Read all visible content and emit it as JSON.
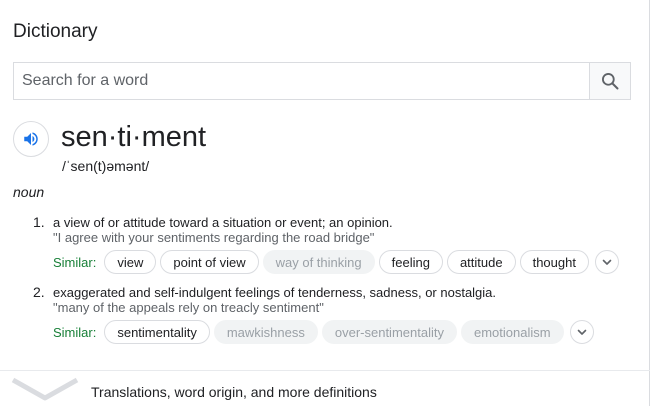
{
  "title": "Dictionary",
  "search": {
    "placeholder": "Search for a word"
  },
  "entry": {
    "word": "sen·ti·ment",
    "phonetic": "/ˈsen(t)əmənt/",
    "part_of_speech": "noun",
    "definitions": [
      {
        "number": "1.",
        "text": "a view of or attitude toward a situation or event; an opinion.",
        "example": "\"I agree with your sentiments regarding the road bridge\"",
        "similar_label": "Similar:",
        "similar": [
          {
            "word": "view",
            "muted": false
          },
          {
            "word": "point of view",
            "muted": false
          },
          {
            "word": "way of thinking",
            "muted": true
          },
          {
            "word": "feeling",
            "muted": false
          },
          {
            "word": "attitude",
            "muted": false
          },
          {
            "word": "thought",
            "muted": false
          }
        ]
      },
      {
        "number": "2.",
        "text": "exaggerated and self-indulgent feelings of tenderness, sadness, or nostalgia.",
        "example": "\"many of the appeals rely on treacly sentiment\"",
        "similar_label": "Similar:",
        "similar": [
          {
            "word": "sentimentality",
            "muted": false
          },
          {
            "word": "mawkishness",
            "muted": true
          },
          {
            "word": "over-sentimentality",
            "muted": true
          },
          {
            "word": "emotionalism",
            "muted": true
          }
        ]
      }
    ]
  },
  "footer": {
    "more_label": "Translations, word origin, and more definitions"
  },
  "colors": {
    "accent_blue": "#1a73e8",
    "similar_green": "#188038"
  }
}
